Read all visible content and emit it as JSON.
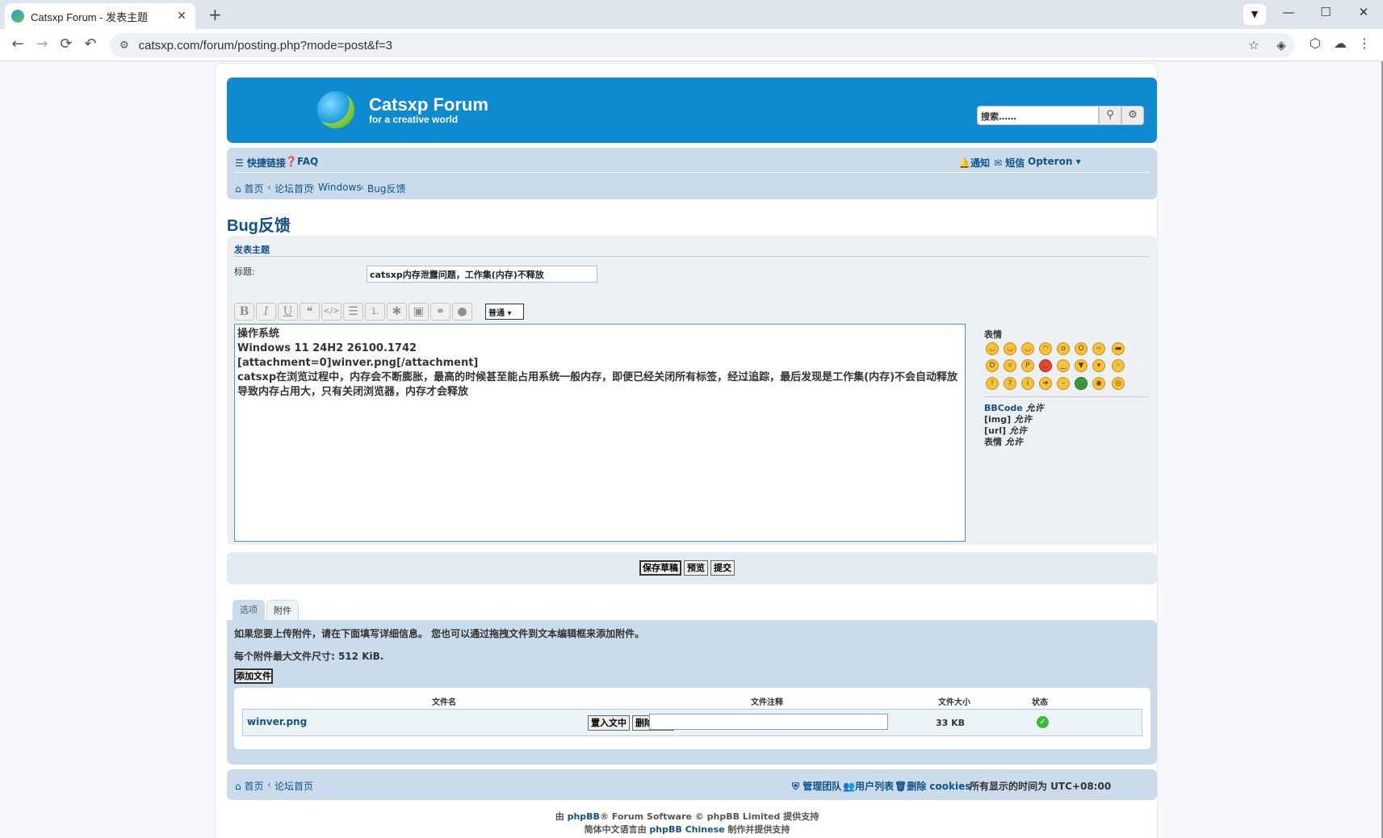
{
  "browser": {
    "tab_title": "Catsxp Forum - 发表主题",
    "url": "catsxp.com/forum/posting.php?mode=post&f=3"
  },
  "header": {
    "site_name": "Catsxp Forum",
    "tagline": "for a creative world",
    "search_placeholder": "搜索……"
  },
  "nav": {
    "quick_links": "快捷链接",
    "faq": "FAQ",
    "notifications": "通知",
    "messages": "短信",
    "username": "Opteron",
    "breadcrumbs": [
      "首页",
      "论坛首页",
      "Windows",
      "Bug反馈"
    ]
  },
  "page": {
    "title": "Bug反馈",
    "section_title": "发表主题",
    "subject_label": "标题:",
    "subject_value": "catsxp内存泄露问题，工作集(内存)不释放",
    "font_size_select": "普通",
    "message_lines": [
      "操作系统",
      "Windows 11 24H2 26100.1742",
      "[attachment=0]winver.png[/attachment]",
      "catsxp在浏览过程中，内存会不断膨胀，最高的时候甚至能占用系统一般内存，即便已经关闭所有标签，经过追踪，最后发现是工作集(内存)不会自动释放导致内存占用大，只有关闭浏览器，内存才会释放"
    ]
  },
  "sidebar": {
    "smilies_label": "表情",
    "permissions": [
      {
        "key": "BBCode",
        "value": "允许"
      },
      {
        "key": "[img]",
        "value": "允许"
      },
      {
        "key": "[url]",
        "value": "允许"
      },
      {
        "key": "表情",
        "value": "允许"
      }
    ]
  },
  "buttons": {
    "save_draft": "保存草稿",
    "preview": "预览",
    "submit": "提交"
  },
  "tabs": {
    "options": "选项",
    "attachments": "附件"
  },
  "attachments": {
    "info": "如果您要上传附件，请在下面填写详细信息。 您也可以通过拖拽文件到文本编辑框来添加附件。",
    "max_size": "每个附件最大文件尺寸:  512 KiB.",
    "add_file": "添加文件",
    "col_filename": "文件名",
    "col_comment": "文件注释",
    "col_size": "文件大小",
    "col_status": "状态",
    "file": {
      "name": "winver.png",
      "place_inline": "置入文中",
      "delete": "删除文件",
      "size": "33 KB"
    }
  },
  "footer": {
    "home": "首页",
    "forum_index": "论坛首页",
    "team": "管理团队",
    "members": "用户列表",
    "delete_cookies": "删除 cookies",
    "timezone": "所有显示的时间为 UTC+08:00",
    "powered_by_pre": "由",
    "powered_by_link": "phpBB",
    "powered_by_post": "® Forum Software © phpBB Limited 提供支持",
    "translation_pre": "简体中文语言由",
    "translation_link": "phpBB Chinese",
    "translation_post": "制作并提供支持"
  }
}
